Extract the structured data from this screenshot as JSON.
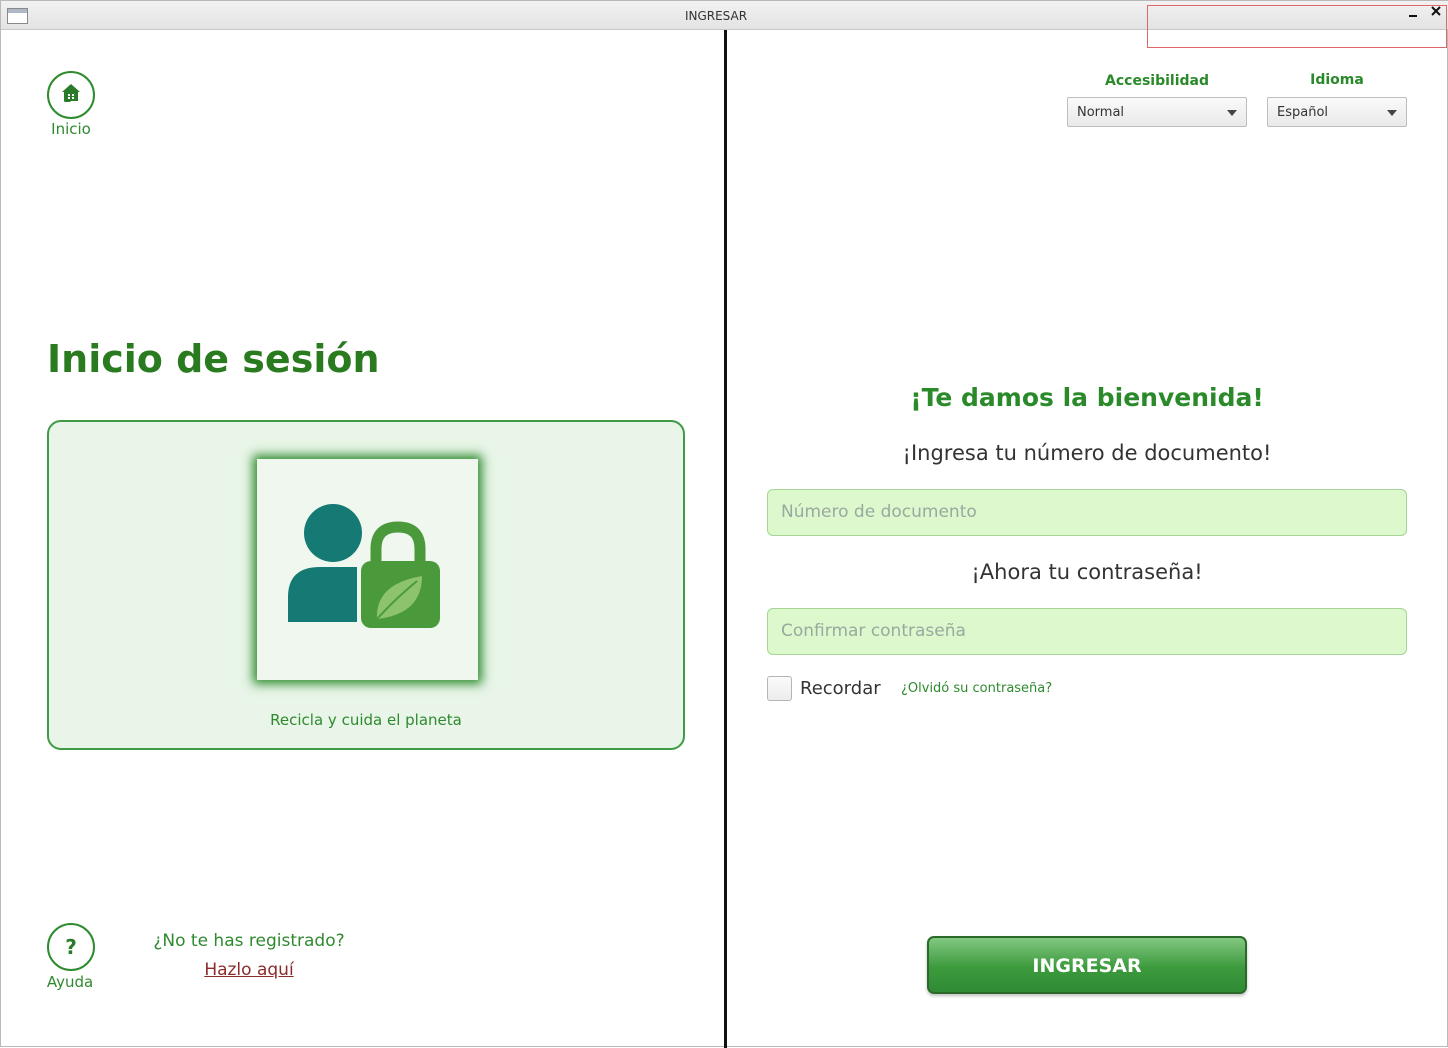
{
  "window": {
    "title": "INGRESAR",
    "minimize_icon": "minimize-icon",
    "close_icon": "close-icon"
  },
  "left": {
    "home_label": "Inicio",
    "help_symbol": "?",
    "help_label": "Ayuda",
    "title": "Inicio de sesión",
    "card_caption": "Recicla y cuida el planeta",
    "register_question": "¿No te has registrado?",
    "register_link": "Hazlo aquí"
  },
  "right": {
    "accessibility": {
      "label": "Accesibilidad",
      "value": "Normal"
    },
    "language": {
      "label": "Idioma",
      "value": "Español"
    },
    "welcome": "¡Te damos la bienvenida!",
    "doc_prompt": "¡Ingresa tu número de documento!",
    "doc_placeholder": "Número de documento",
    "pass_prompt": "¡Ahora tu contraseña!",
    "pass_placeholder": "Confirmar contraseña",
    "remember_label": "Recordar",
    "forgot_link": "¿Olvidó su contraseña?",
    "submit_label": "INGRESAR"
  },
  "colors": {
    "primary_green": "#2a8a2a",
    "input_bg": "#dcf8cc",
    "card_bg": "#e8f5e8",
    "link_red": "#8b2b2b",
    "teal_user": "#167a74",
    "lock_green": "#4a9a3c"
  }
}
